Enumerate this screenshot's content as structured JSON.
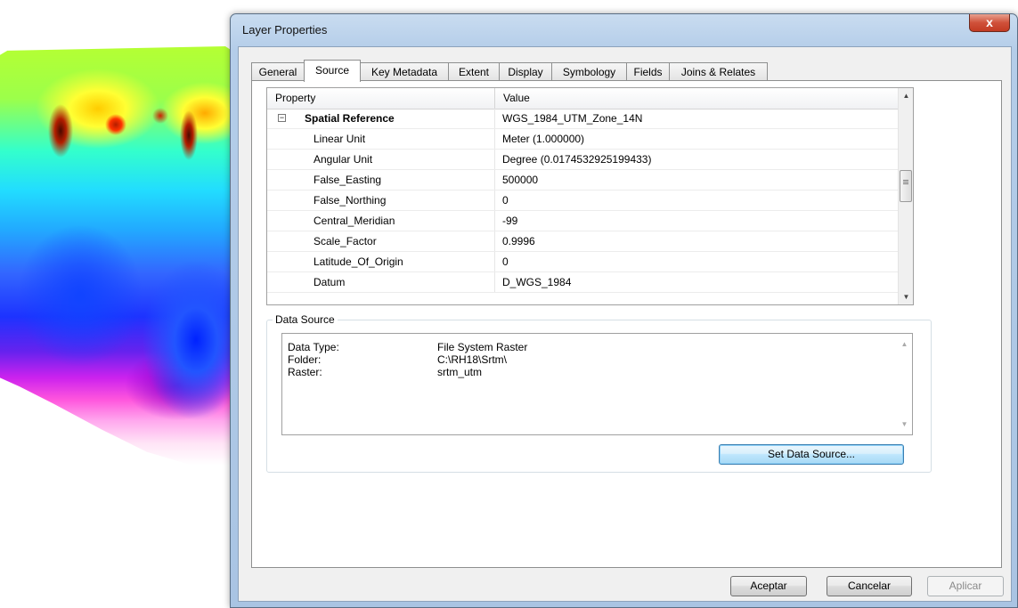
{
  "window": {
    "title": "Layer Properties",
    "close_label": "x"
  },
  "tabs": [
    {
      "label": "General"
    },
    {
      "label": "Source"
    },
    {
      "label": "Key Metadata"
    },
    {
      "label": "Extent"
    },
    {
      "label": "Display"
    },
    {
      "label": "Symbology"
    },
    {
      "label": "Fields"
    },
    {
      "label": "Joins & Relates"
    }
  ],
  "active_tab": "Source",
  "property_grid": {
    "headers": {
      "property": "Property",
      "value": "Value"
    },
    "group": {
      "name": "Spatial Reference",
      "value": "WGS_1984_UTM_Zone_14N",
      "expander": "−"
    },
    "rows": [
      {
        "property": "Linear Unit",
        "value": "Meter (1.000000)"
      },
      {
        "property": "Angular Unit",
        "value": "Degree (0.0174532925199433)"
      },
      {
        "property": "False_Easting",
        "value": "500000"
      },
      {
        "property": "False_Northing",
        "value": "0"
      },
      {
        "property": "Central_Meridian",
        "value": "-99"
      },
      {
        "property": "Scale_Factor",
        "value": "0.9996"
      },
      {
        "property": "Latitude_Of_Origin",
        "value": "0"
      },
      {
        "property": "Datum",
        "value": "D_WGS_1984"
      }
    ]
  },
  "data_source": {
    "group_label": "Data Source",
    "rows": [
      {
        "key": "Data Type:",
        "value": "File System Raster"
      },
      {
        "key": "Folder:",
        "value": "C:\\RH18\\Srtm\\"
      },
      {
        "key": "Raster:",
        "value": "srtm_utm"
      }
    ],
    "set_button": "Set Data Source..."
  },
  "buttons": {
    "ok": "Aceptar",
    "cancel": "Cancelar",
    "apply": "Aplicar"
  }
}
